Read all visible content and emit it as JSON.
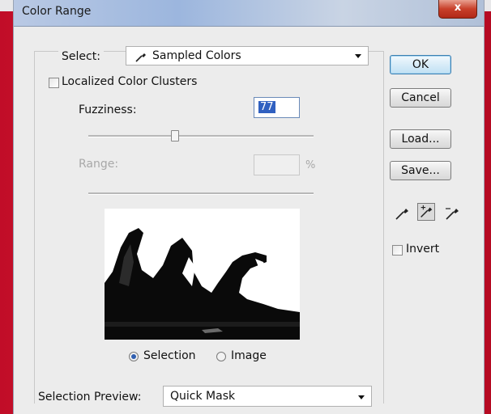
{
  "window": {
    "title": "Color Range",
    "close_label": "x"
  },
  "select": {
    "label": "Select:",
    "value": "Sampled Colors"
  },
  "localized": {
    "label": "Localized Color Clusters",
    "checked": false
  },
  "fuzziness": {
    "label": "Fuzziness:",
    "value": "77"
  },
  "range": {
    "label": "Range:",
    "value": "",
    "unit": "%"
  },
  "view": {
    "selection_label": "Selection",
    "image_label": "Image",
    "selected": "selection"
  },
  "buttons": {
    "ok": "OK",
    "cancel": "Cancel",
    "load": "Load...",
    "save": "Save..."
  },
  "invert": {
    "label": "Invert",
    "checked": false
  },
  "selection_preview": {
    "label": "Selection Preview:",
    "value": "Quick Mask"
  },
  "icons": [
    "eyedropper-icon",
    "eyedropper-plus-icon",
    "eyedropper-minus-icon",
    "dropdown-arrow-icon"
  ]
}
